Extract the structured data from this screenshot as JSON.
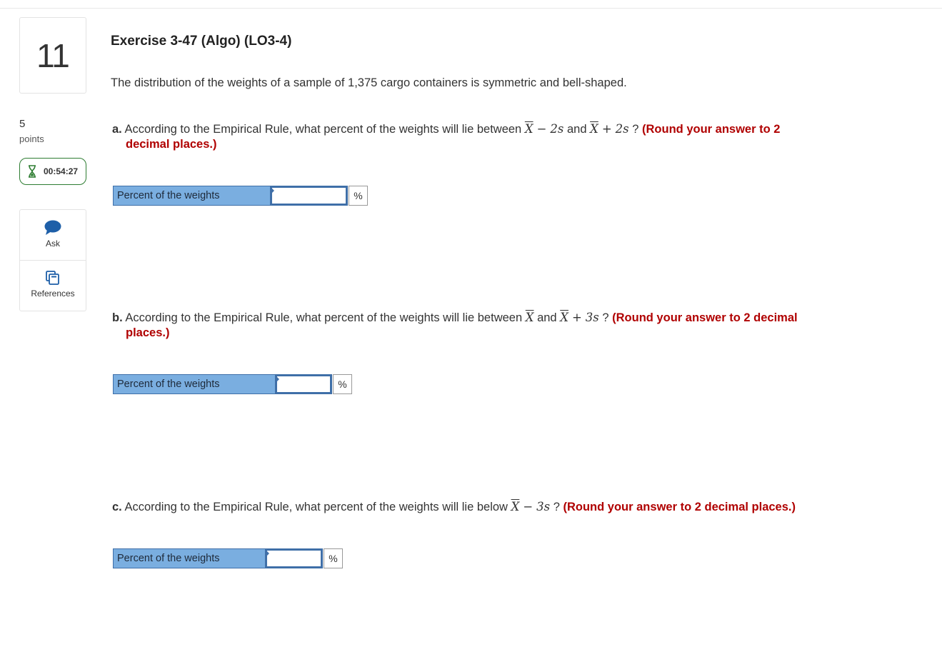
{
  "question": {
    "number": "11",
    "points_value": "5",
    "points_label": "points",
    "timer": "00:54:27"
  },
  "tools": {
    "ask_label": "Ask",
    "references_label": "References"
  },
  "exercise": {
    "title": "Exercise 3-47 (Algo) (LO3-4)",
    "intro": "The distribution of the weights of a sample of 1,375 cargo containers is symmetric and bell-shaped."
  },
  "parts": {
    "a": {
      "letter": "a.",
      "text_before": "According to the Empirical Rule, what percent of the weights will lie between",
      "x1": "X",
      "op1": "−",
      "k1": "2s",
      "mid": "and",
      "x2": "X",
      "op2": "+",
      "k2": "2s",
      "qmark": "?",
      "note_line1": "(Round your answer to 2",
      "note_line2": "decimal places.)",
      "answer_label": "Percent of the weights",
      "answer_value": "",
      "unit": "%"
    },
    "b": {
      "letter": "b.",
      "text_before": "According to the Empirical Rule, what percent of the weights will lie between",
      "x1": "X",
      "mid": "and",
      "x2": "X",
      "op2": "+",
      "k2": "3s",
      "qmark": "?",
      "note_line1": "(Round your answer to 2 decimal",
      "note_line2": "places.)",
      "answer_label": "Percent of the weights",
      "answer_value": "",
      "unit": "%"
    },
    "c": {
      "letter": "c.",
      "text_before": "According to the Empirical Rule, what percent of the weights will lie below",
      "x1": "X",
      "op1": "−",
      "k1": "3s",
      "qmark": "?",
      "note": "(Round your answer to 2 decimal places.)",
      "answer_label": "Percent of the weights",
      "answer_value": "",
      "unit": "%"
    }
  },
  "colors": {
    "note_red": "#b00000",
    "label_blue": "#7aaee0",
    "timer_green": "#2e7d32"
  }
}
